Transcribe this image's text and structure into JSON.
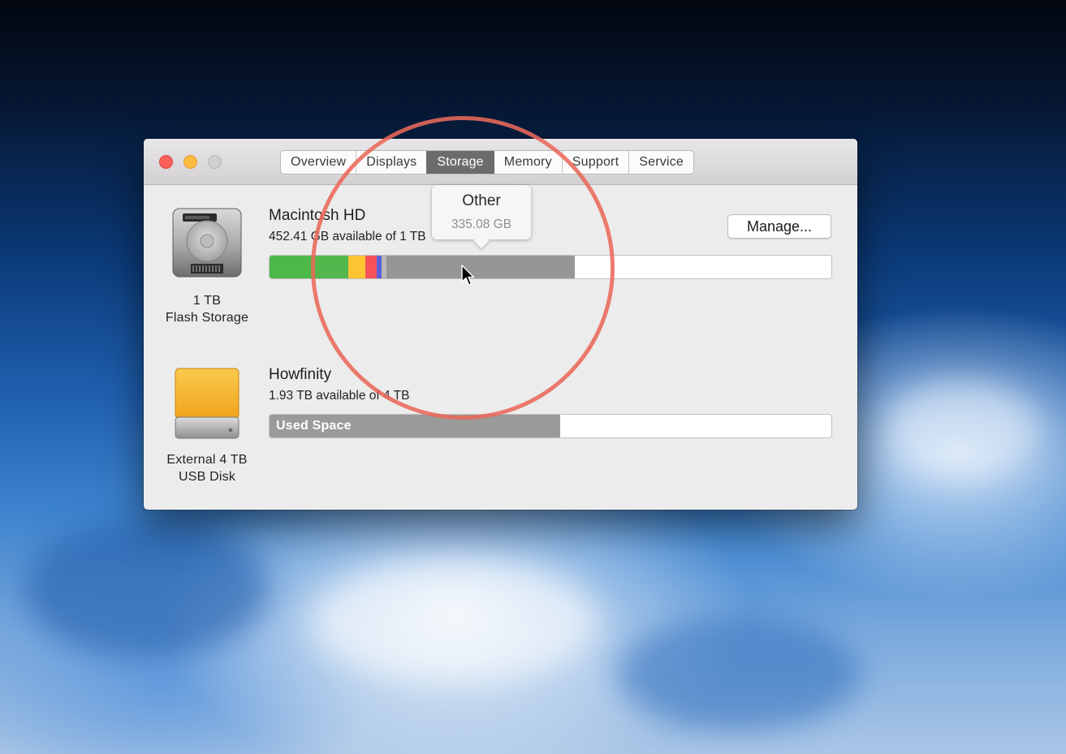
{
  "window": {
    "tabs": [
      "Overview",
      "Displays",
      "Storage",
      "Memory",
      "Support",
      "Service"
    ],
    "active_tab": "Storage"
  },
  "disks": [
    {
      "icon": "internal-drive-icon",
      "caption_line1": "1 TB",
      "caption_line2": "Flash Storage",
      "name": "Macintosh HD",
      "available": "452.41 GB available of 1 TB",
      "manage_label": "Manage...",
      "segments": [
        {
          "color": "#4cb848",
          "fraction": 0.08
        },
        {
          "color": "#52b84e",
          "fraction": 0.06
        },
        {
          "color": "#fcc531",
          "fraction": 0.03
        },
        {
          "color": "#f5525a",
          "fraction": 0.02
        },
        {
          "color": "#5a60d8",
          "fraction": 0.008
        },
        {
          "color": "#b7b7b7",
          "fraction": 0.009
        },
        {
          "color": "#969696",
          "fraction": 0.335
        }
      ],
      "tooltip": {
        "title": "Other",
        "value": "335.08 GB"
      }
    },
    {
      "icon": "external-usb-drive-icon",
      "caption_line1": "External 4 TB",
      "caption_line2": "USB Disk",
      "name": "Howfinity",
      "available": "1.93 TB available of 4 TB",
      "used_label": "Used Space",
      "used_fraction": 0.518,
      "used_color": "#9a9a9a"
    }
  ]
}
